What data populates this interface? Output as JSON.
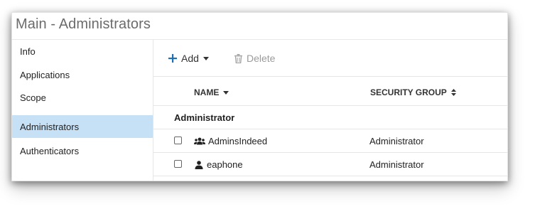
{
  "window": {
    "title": "Main - Administrators"
  },
  "sidebar": {
    "items": [
      {
        "label": "Info"
      },
      {
        "label": "Applications"
      },
      {
        "label": "Scope"
      },
      {
        "label": "Administrators",
        "active": true
      },
      {
        "label": "Authenticators"
      }
    ]
  },
  "toolbar": {
    "add_label": "Add",
    "delete_label": "Delete"
  },
  "table": {
    "columns": {
      "name": "NAME",
      "security_group": "SECURITY GROUP"
    },
    "group_header": "Administrator",
    "rows": [
      {
        "icon": "users-icon",
        "name": "AdminsIndeed",
        "security_group": "Administrator"
      },
      {
        "icon": "user-icon",
        "name": "eaphone",
        "security_group": "Administrator"
      }
    ]
  },
  "colors": {
    "accent": "#1f6fb2",
    "active_nav": "#c6e0f5",
    "title_text": "#6b6b6b"
  }
}
